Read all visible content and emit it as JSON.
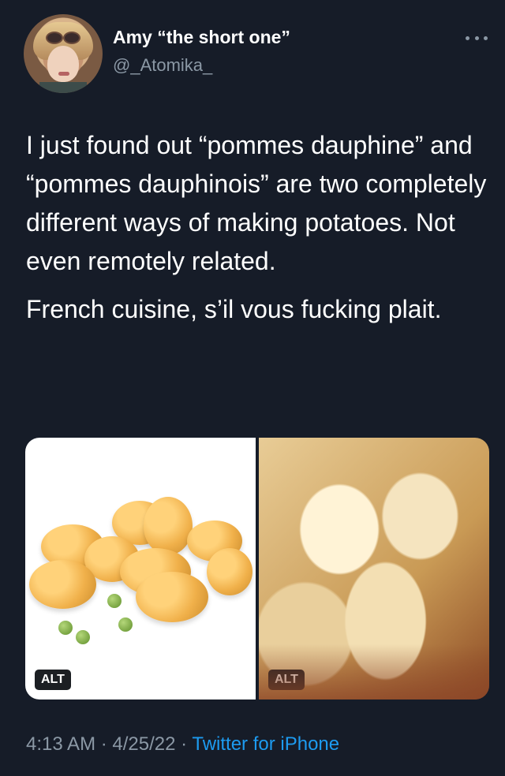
{
  "user": {
    "display_name": "Amy “the short one”",
    "handle": "@_Atomika_",
    "avatar_icon": "profile-photo"
  },
  "more_icon": "more-dots-icon",
  "tweet": {
    "paragraphs": [
      "I just found out “pommes dauphine” and “pommes dauphinois” are two completely different ways of making potatoes. Not even remotely related.",
      "French cuisine, s’il vous fucking plait."
    ]
  },
  "media": {
    "left_alt_badge": "ALT",
    "right_alt_badge": "ALT"
  },
  "meta": {
    "time": "4:13 AM",
    "separator1": " · ",
    "date": "4/25/22",
    "separator2": " · ",
    "source": "Twitter for iPhone"
  },
  "colors": {
    "background": "#161c28",
    "link": "#1d9bf0",
    "muted": "#8b98a5"
  }
}
